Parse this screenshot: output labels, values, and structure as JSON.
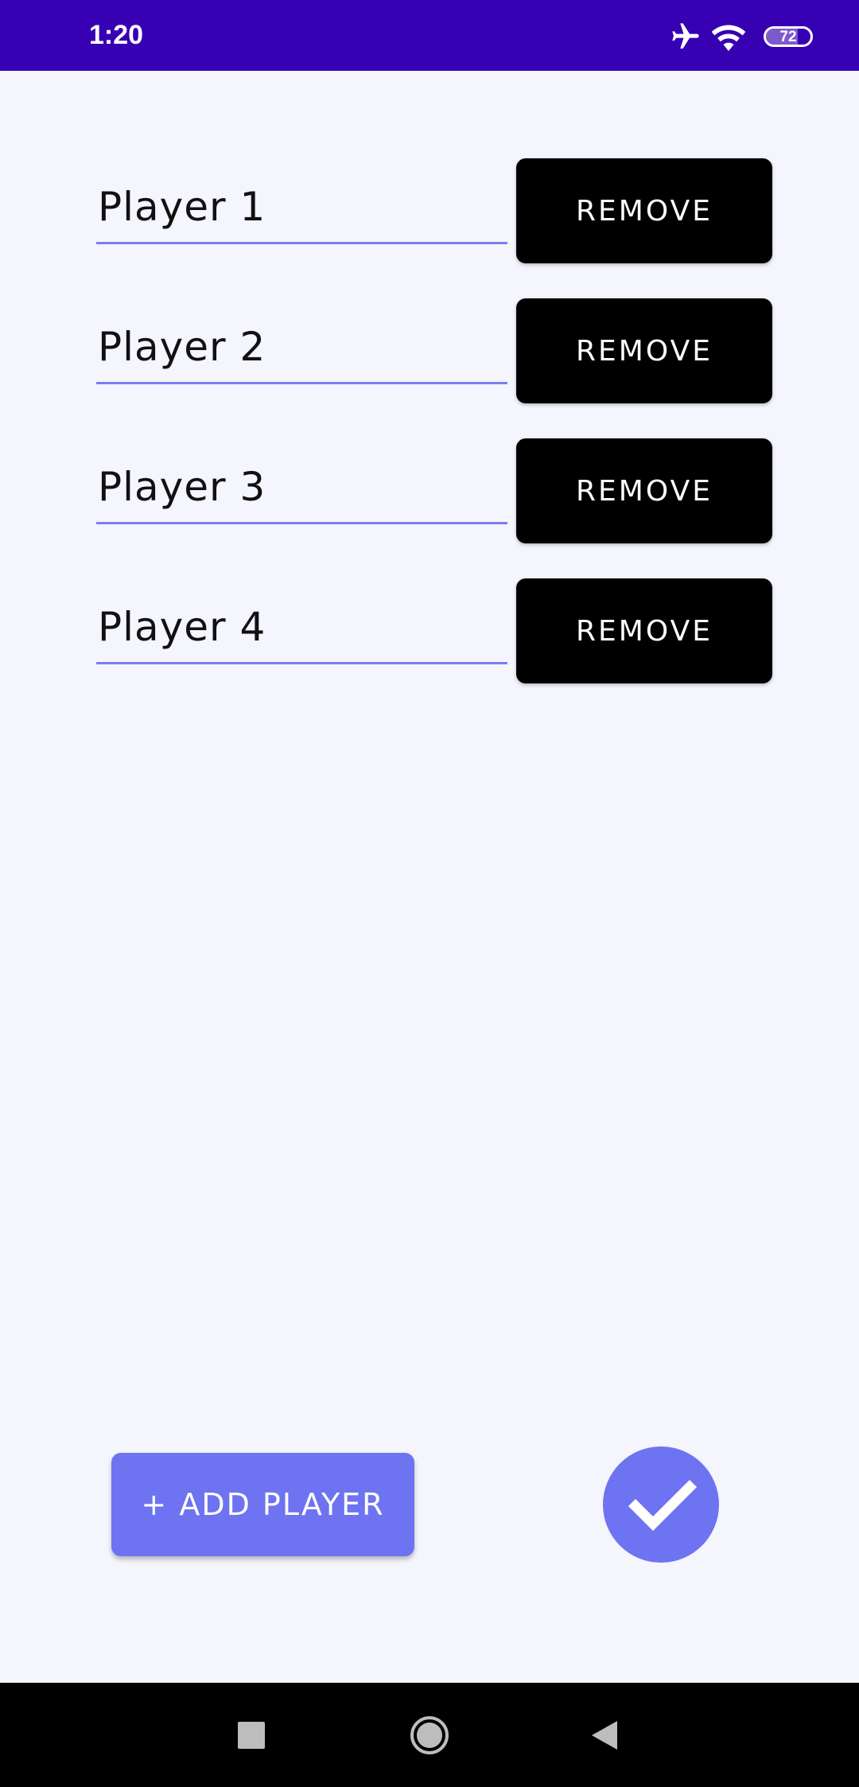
{
  "status_bar": {
    "time": "1:20",
    "battery": "72",
    "battery_level_percent": 72,
    "icons": [
      "airplane-mode-icon",
      "wifi-icon",
      "battery-icon"
    ],
    "background_color": "#3700b3"
  },
  "players": [
    {
      "name": "Player 1",
      "remove_label": "REMOVE"
    },
    {
      "name": "Player 2",
      "remove_label": "REMOVE"
    },
    {
      "name": "Player 3",
      "remove_label": "REMOVE"
    },
    {
      "name": "Player 4",
      "remove_label": "REMOVE"
    }
  ],
  "actions": {
    "add_player_label": "+ ADD PLAYER",
    "confirm_icon": "checkmark-icon",
    "accent_color": "#6e73f1"
  },
  "nav_bar": {
    "icons": [
      "recent-apps-icon",
      "home-icon",
      "back-icon"
    ]
  }
}
